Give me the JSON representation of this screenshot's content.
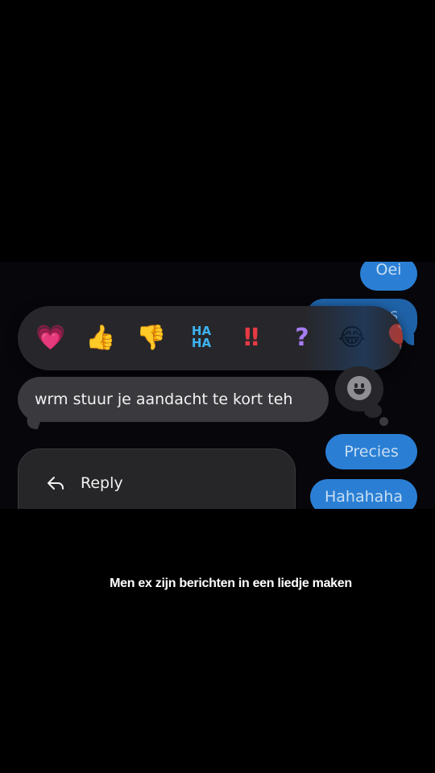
{
  "conversation": {
    "outgoing": [
      {
        "text": "Oei"
      },
      {
        "text": "s"
      },
      {
        "text": "Precies"
      },
      {
        "text": "Hahahaha"
      }
    ],
    "incoming": [
      {
        "text": "wrm stuur je aandacht te kort teh"
      }
    ]
  },
  "reactions": [
    {
      "name": "heart",
      "glyph": "💗"
    },
    {
      "name": "thumbs-up",
      "glyph": "👍"
    },
    {
      "name": "thumbs-down",
      "glyph": "👎"
    },
    {
      "name": "haha",
      "glyph_top": "HA",
      "glyph_bottom": "HA"
    },
    {
      "name": "exclamation",
      "glyph": "‼"
    },
    {
      "name": "question",
      "glyph": "?"
    },
    {
      "name": "laughing",
      "glyph": "😂"
    },
    {
      "name": "more",
      "glyph": "🎈"
    }
  ],
  "context_menu": {
    "reply_label": "Reply"
  },
  "caption": "Men ex zijn berichten in een liedje maken",
  "colors": {
    "outgoing_bubble": "#2a7fd4",
    "incoming_bubble": "#3a3a3e",
    "reaction_bar": "#27272b",
    "background": "#000000"
  }
}
